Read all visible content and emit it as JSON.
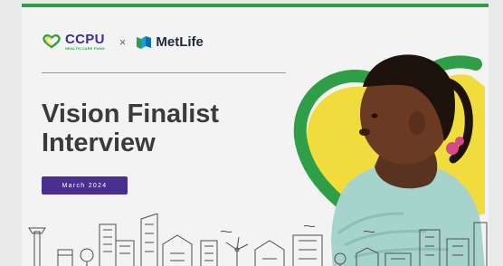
{
  "header": {
    "ccpu_name": "CCPU",
    "ccpu_subtitle": "HEALTH CARE FUND",
    "separator": "×",
    "metlife_name": "MetLife"
  },
  "title": {
    "line1": "Vision Finalist",
    "line2": "Interview"
  },
  "date_badge": "March 2024",
  "colors": {
    "brand_green": "#2e9e47",
    "brand_yellow": "#f0dc3c",
    "brand_purple": "#4a2f91",
    "title_gray": "#3b3b3b"
  }
}
